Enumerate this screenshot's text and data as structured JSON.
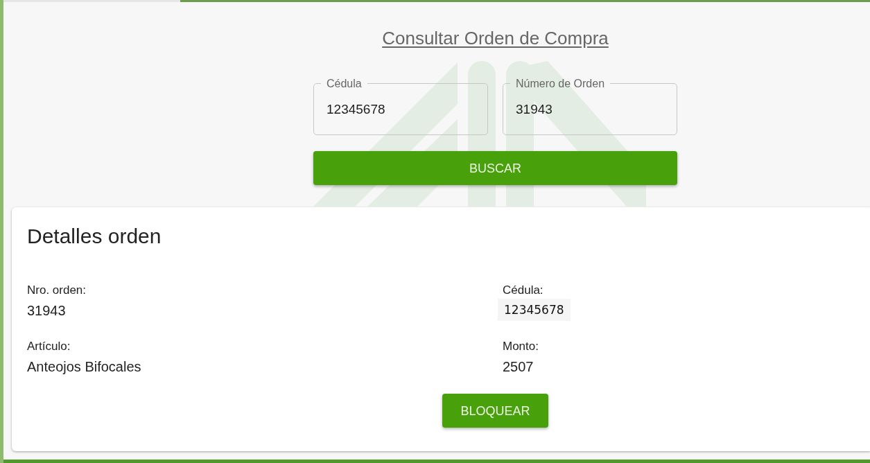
{
  "page_title": "Consultar Orden de Compra",
  "search_form": {
    "fields": [
      {
        "label": "Cédula",
        "value": "12345678"
      },
      {
        "label": "Número de Orden",
        "value": "31943"
      }
    ],
    "button": "BUSCAR"
  },
  "order_details": {
    "title": "Detalles orden",
    "fields": [
      {
        "label": "Nro. orden:",
        "value": "31943",
        "kind": "plain"
      },
      {
        "label": "Cédula:",
        "value": "12345678",
        "kind": "shaded"
      },
      {
        "label": "Artículo:",
        "value": "Anteojos Bifocales",
        "kind": "plain"
      },
      {
        "label": "Monto:",
        "value": "2507",
        "kind": "plain"
      }
    ],
    "button": "BLOQUEAR"
  }
}
